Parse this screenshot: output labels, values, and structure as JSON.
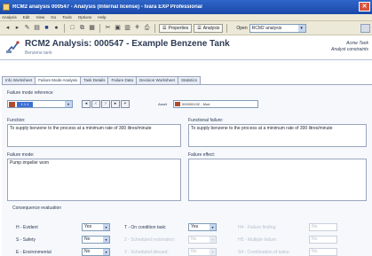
{
  "window": {
    "title": "RCM2 analysis 000547 - Analysis (Internal license) - Ivara EXP Professional"
  },
  "menu": [
    "Analysis",
    "Edit",
    "View",
    "Go",
    "Tools",
    "Options",
    "Help"
  ],
  "toolbar": {
    "properties_label": "Properties",
    "analysis_label": "Analysis",
    "open_label": "Open",
    "open_value": "RCM2 analysis"
  },
  "header": {
    "title": "RCM2 Analysis: 000547 - Example Benzene Tank",
    "subtitle": "Benzene tank",
    "side_line1": "Acme Tank",
    "side_line2": "Analyst constraints"
  },
  "tabs": [
    "Info Worksheet",
    "Failure Mode Analysis",
    "Task Details",
    "Failure Data",
    "Decision Worksheet",
    "Statistics"
  ],
  "form": {
    "failure_mode_reference_label": "Failure mode reference",
    "reference_value": "1.1.1",
    "asset_label": "Asset",
    "asset_value": "000000192 - Mod",
    "function_label": "Function:",
    "function_value": "To supply benzene to the process at a minimum rate of 300 litres/minute",
    "functional_failure_label": "Functional failure:",
    "functional_failure_value": "To supply benzene to the process at a minimum rate of 300 litres/minute",
    "failure_mode_label": "Failure mode:",
    "failure_mode_value": "Pump impeller worn",
    "failure_effect_label": "Failure effect:",
    "failure_effect_value": ""
  },
  "consequence": {
    "section_label": "Consequence evaluation",
    "h_evident_label": "H - Evident",
    "h_evident_value": "Yes",
    "s_safety_label": "S - Safety",
    "s_safety_value": "No",
    "e_env_label": "E - Environmental",
    "e_env_value": "No",
    "t1_label": "T - On condition task:",
    "t1_value": "Yes",
    "t2_label": "2 - Scheduled restoration:",
    "t2_value": "No",
    "t3_label": "3 - Scheduled discard:",
    "t3_value": "No",
    "h4_label": "H4 - Failure finding:",
    "h4_value": "No",
    "h5_label": "H5 - Multiple failure:",
    "h5_value": "No",
    "s4_label": "S4 - Combination of tasks:",
    "s4_value": "No"
  }
}
